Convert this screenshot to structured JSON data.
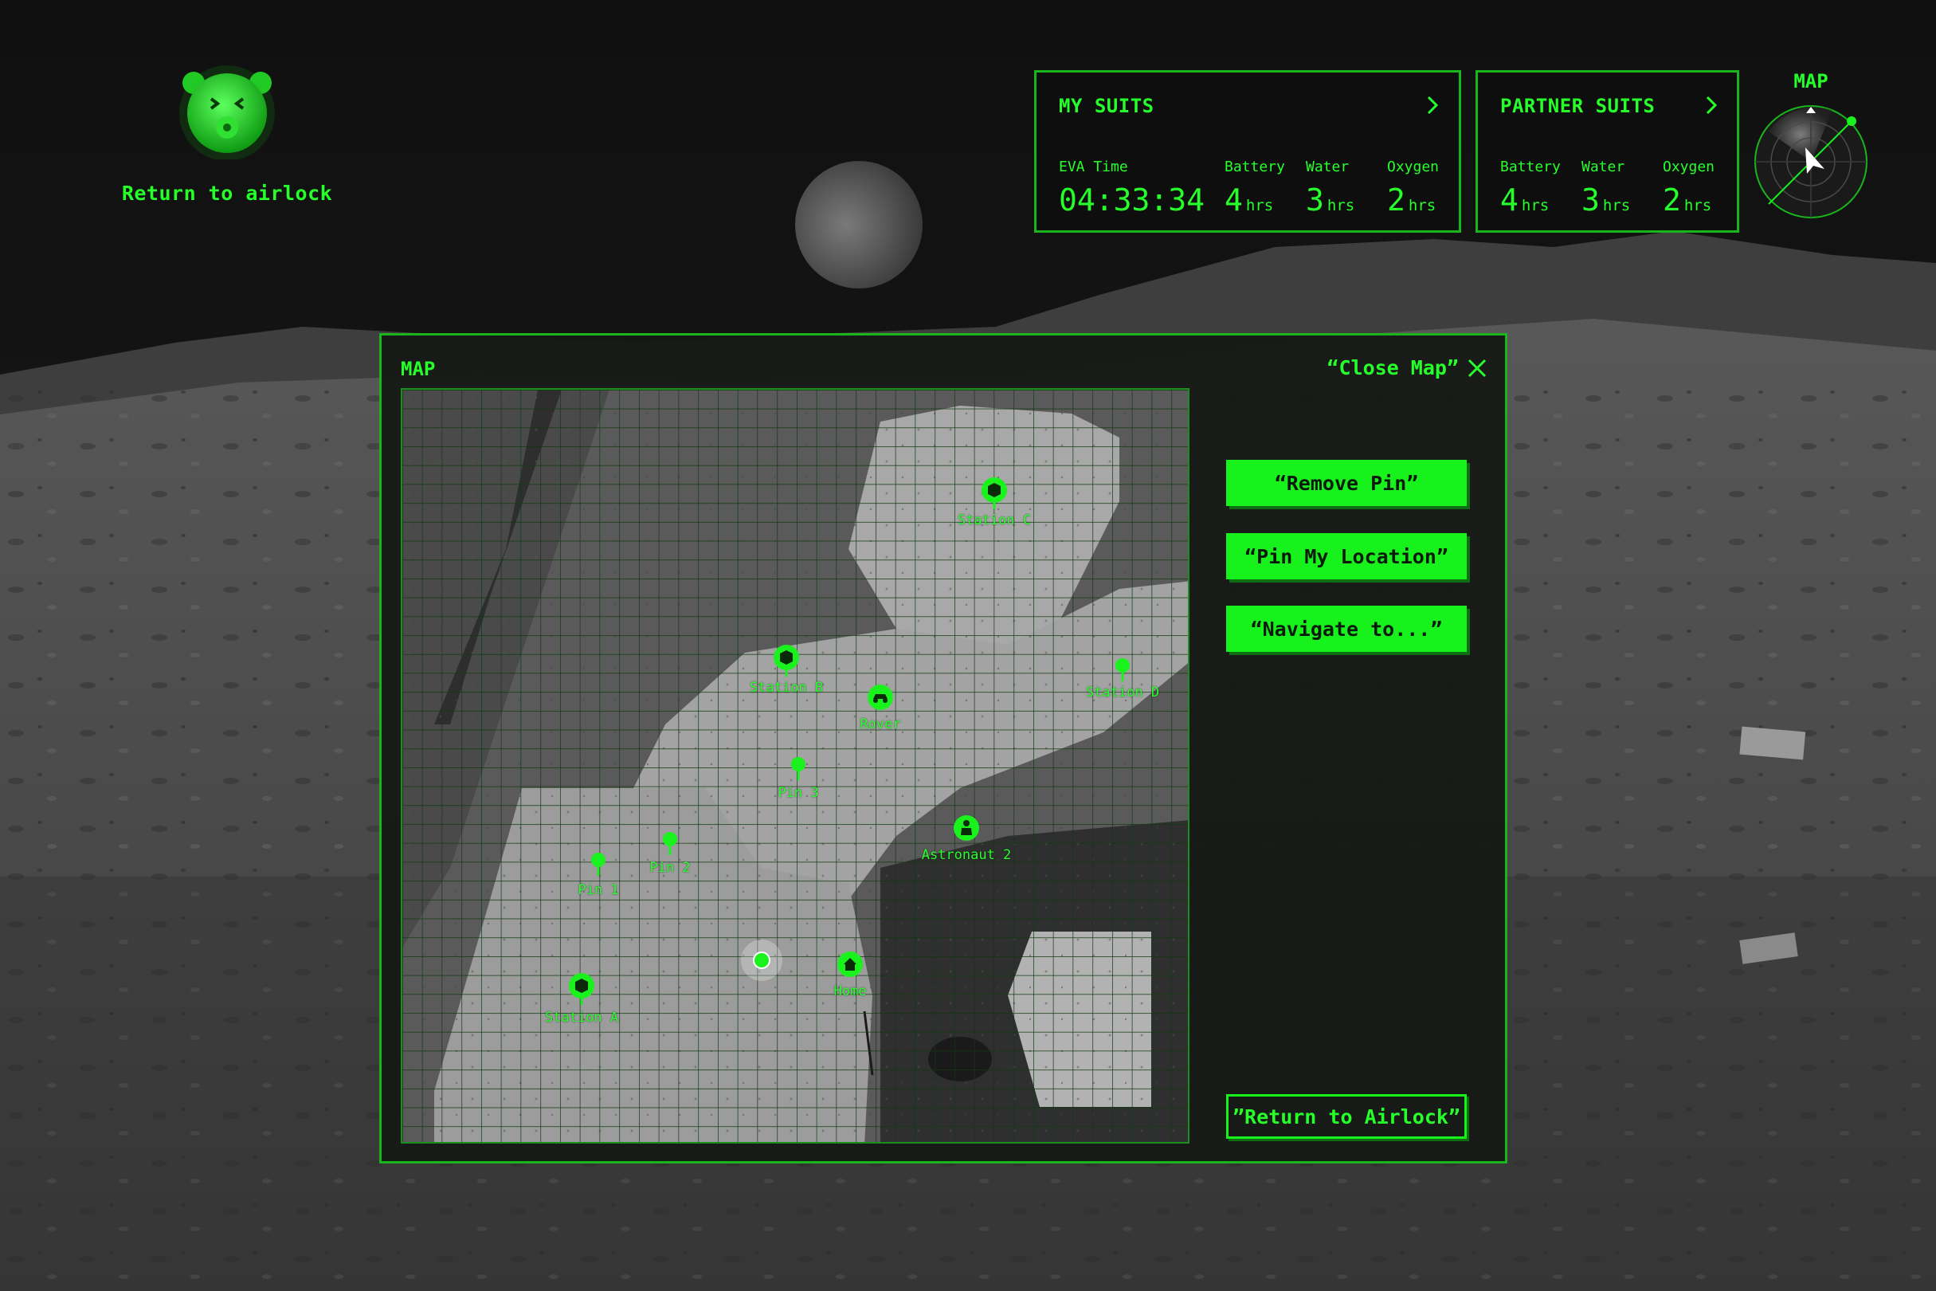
{
  "airlock": {
    "label": "Return to airlock",
    "icon": "bear-icon"
  },
  "my_suits": {
    "title": "MY SUITS",
    "eva_time_label": "EVA Time",
    "eva_time": "04:33:34",
    "battery_label": "Battery",
    "battery_value": "4",
    "water_label": "Water",
    "water_value": "3",
    "oxygen_label": "Oxygen",
    "oxygen_value": "2",
    "unit": "hrs"
  },
  "partner_suits": {
    "title": "PARTNER SUITS",
    "battery_label": "Battery",
    "battery_value": "4",
    "water_label": "Water",
    "water_value": "3",
    "oxygen_label": "Oxygen",
    "oxygen_value": "2",
    "unit": "hrs"
  },
  "radar": {
    "title": "MAP"
  },
  "map_modal": {
    "title": "MAP",
    "close_label": "“Close Map”",
    "buttons": {
      "remove_pin": "“Remove Pin”",
      "pin_location": "“Pin My Location”",
      "navigate": "“Navigate to...”",
      "return_airlock": "”Return to Airlock”"
    },
    "markers": [
      {
        "label": "Station C",
        "icon": "station-icon"
      },
      {
        "label": "Station B",
        "icon": "station-icon"
      },
      {
        "label": "Rover",
        "icon": "rover-icon"
      },
      {
        "label": "Station D",
        "icon": "pin-icon"
      },
      {
        "label": "Pin 3",
        "icon": "pin-icon"
      },
      {
        "label": "Astronaut 2",
        "icon": "astronaut-icon"
      },
      {
        "label": "Pin 2",
        "icon": "pin-icon"
      },
      {
        "label": "Pin 1",
        "icon": "pin-icon"
      },
      {
        "label": "Home",
        "icon": "home-icon"
      },
      {
        "label": "Station A",
        "icon": "station-icon"
      }
    ]
  },
  "colors": {
    "accent": "#19f21c",
    "border": "#18b51c",
    "panel_bg": "#0e0e0e"
  }
}
